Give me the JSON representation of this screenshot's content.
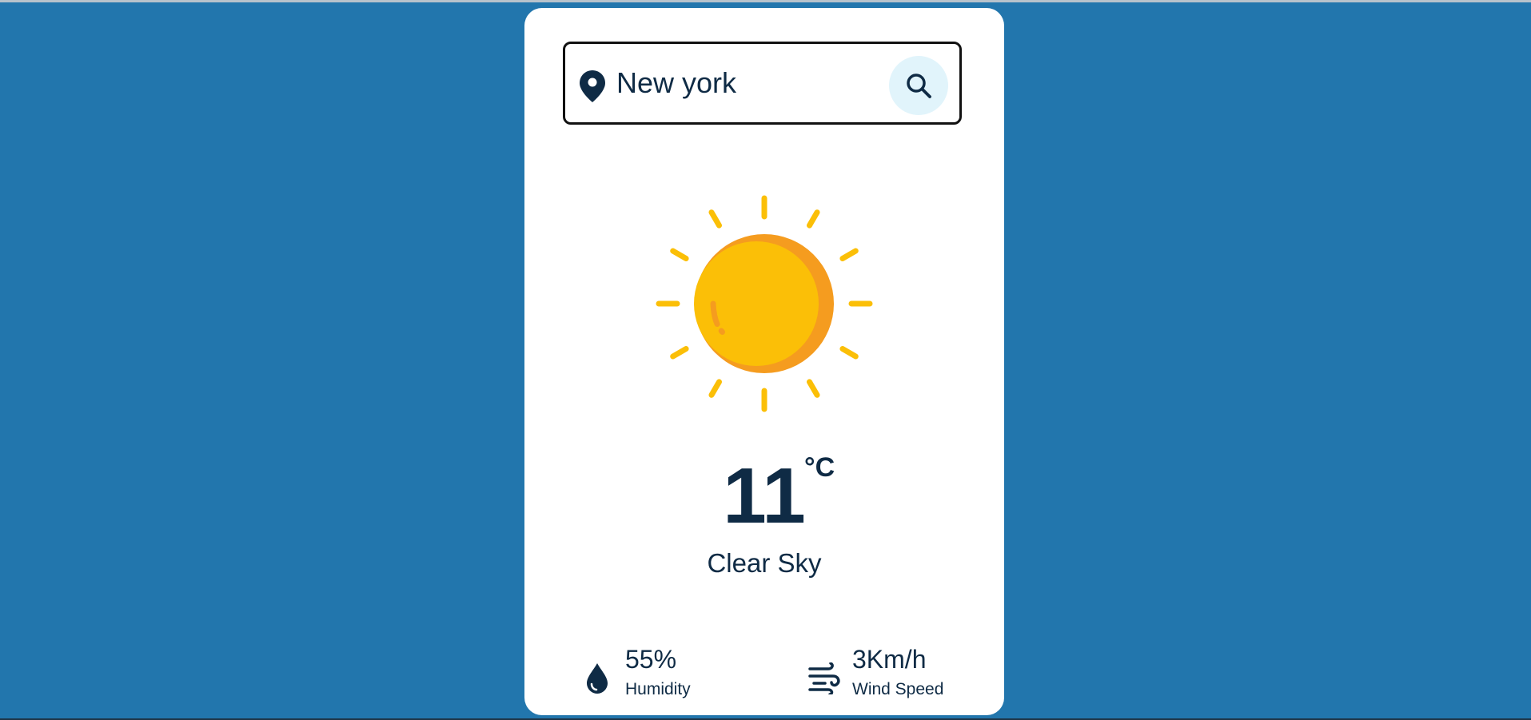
{
  "search": {
    "value": "New york",
    "placeholder": "Search",
    "location_icon": "map-pin-icon",
    "button_icon": "search-icon"
  },
  "weather": {
    "icon": "sun-icon",
    "temperature": "11",
    "unit": "°C",
    "description": "Clear Sky"
  },
  "stats": {
    "humidity": {
      "value": "55%",
      "label": "Humidity",
      "icon": "water-drop-icon"
    },
    "wind": {
      "value": "3Km/h",
      "label": "Wind Speed",
      "icon": "wind-icon"
    }
  },
  "colors": {
    "background": "#2276ad",
    "card": "#ffffff",
    "text": "#0f2b45",
    "sun": "#fbbf07",
    "sun_shade": "#f59c1f",
    "search_button": "#e1f4fb"
  }
}
